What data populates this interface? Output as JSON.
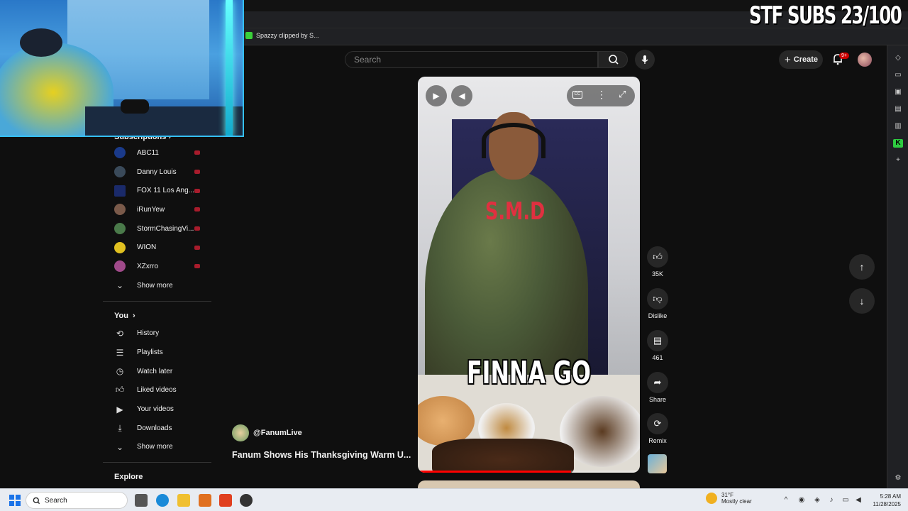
{
  "overlay": {
    "sub_goal": "STF SUBS 23/100"
  },
  "browser": {
    "bookmark_label": "Spazzy clipped by S..."
  },
  "header": {
    "search_placeholder": "Search",
    "create_label": "Create",
    "notifications_badge": "9+"
  },
  "sidebar": {
    "subscriptions_title": "Subscriptions",
    "channels": [
      {
        "name": "ABC11",
        "color": "#1a3a8a"
      },
      {
        "name": "Danny Louis",
        "color": "#3a4a5a"
      },
      {
        "name": "FOX 11 Los Ang...",
        "color": "#1a2a6a"
      },
      {
        "name": "iRunYew",
        "color": "#7a5a4a"
      },
      {
        "name": "StormChasingVi...",
        "color": "#4a7a4a"
      },
      {
        "name": "WION",
        "color": "#e0c020"
      },
      {
        "name": "XZxrro",
        "color": "#a04a8a"
      }
    ],
    "show_more_1": "Show more",
    "you_title": "You",
    "you_items": [
      {
        "label": "History",
        "icon": "history-icon"
      },
      {
        "label": "Playlists",
        "icon": "playlists-icon"
      },
      {
        "label": "Watch later",
        "icon": "clock-icon"
      },
      {
        "label": "Liked videos",
        "icon": "thumb-up-icon"
      },
      {
        "label": "Your videos",
        "icon": "video-icon"
      },
      {
        "label": "Downloads",
        "icon": "download-icon"
      }
    ],
    "show_more_2": "Show more",
    "explore_title": "Explore"
  },
  "short": {
    "caption": "FINNA GO",
    "shirt_text": "S.M.D",
    "progress_percent": 69,
    "channel": "@FanumLive",
    "title": "Fanum Shows His Thanksgiving Warm U...",
    "actions": {
      "likes": "35K",
      "dislike": "Dislike",
      "comments": "461",
      "share": "Share",
      "remix": "Remix"
    }
  },
  "taskbar": {
    "search_label": "Search",
    "weather_temp": "31°F",
    "weather_desc": "Mostly clear",
    "time": "5:28 AM",
    "date": "11/28/2025"
  }
}
